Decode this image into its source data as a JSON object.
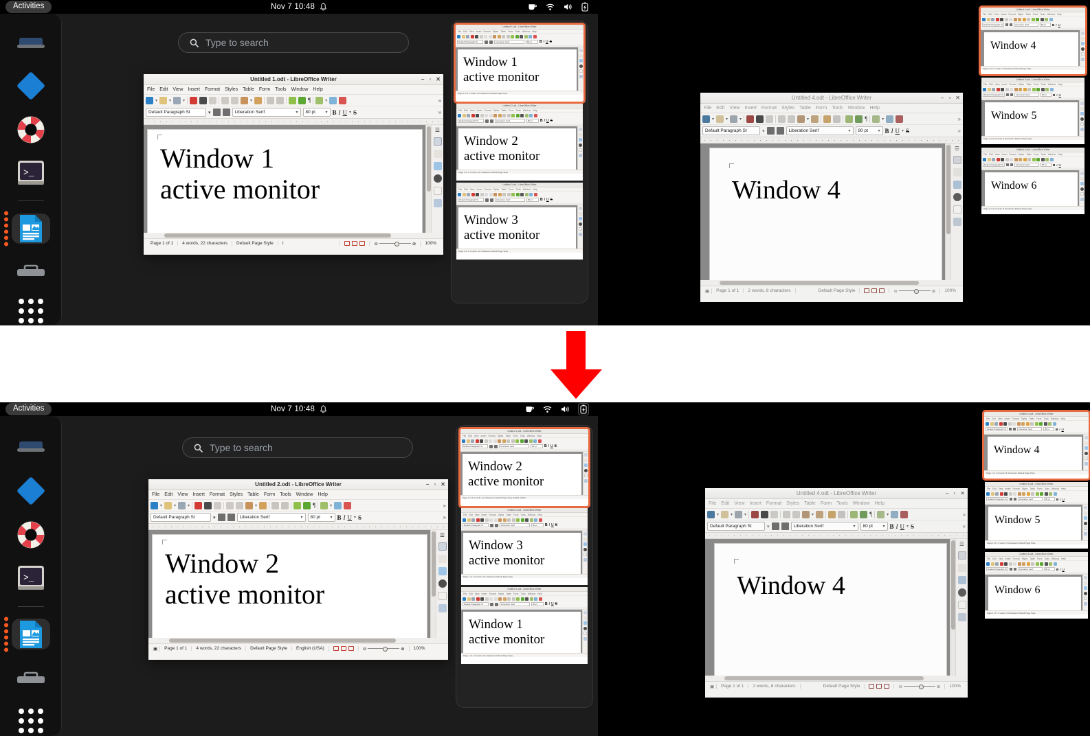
{
  "meta": {
    "description": "GNOME Shell Activities overview, before-and-after comparison of window focus across monitors",
    "accent_selected": "#e86a41",
    "arrow_color": "#ff0000",
    "panel_bg": "#000000",
    "overview_bg": "#1c1c1c"
  },
  "topbar": {
    "activities_label": "Activities",
    "clock": "Nov 7 10:48",
    "icons": [
      "bell-icon",
      "coffee-icon",
      "wifi-icon",
      "volume-icon",
      "battery-charging-icon"
    ]
  },
  "dock": {
    "items": [
      {
        "name": "system-settings",
        "icon": "blue-diamond-gear-icon"
      },
      {
        "name": "help",
        "icon": "lifebuoy-icon"
      },
      {
        "name": "terminal",
        "icon": "terminal-icon"
      },
      {
        "name": "libreoffice-writer",
        "icon": "writer-document-icon",
        "running_count": 6,
        "active": true
      },
      {
        "name": "files",
        "icon": "file-cabinet-icon"
      },
      {
        "name": "show-applications",
        "icon": "app-grid-icon"
      }
    ]
  },
  "search": {
    "placeholder": "Type to search",
    "icon": "search-icon"
  },
  "writer_ui": {
    "menu": [
      "File",
      "Edit",
      "View",
      "Insert",
      "Format",
      "Styles",
      "Table",
      "Form",
      "Tools",
      "Window",
      "Help"
    ],
    "paragraph_style": "Default Paragraph St",
    "font_name": "Liberation Serif",
    "font_size": "80 pt",
    "bold": "B",
    "italic": "I",
    "underline": "U",
    "strike": "S",
    "window_buttons": [
      "minimize",
      "maximize",
      "close"
    ],
    "overflow": "»"
  },
  "top_section": {
    "left_window": {
      "title": "Untitled 1.odt - LibreOffice Writer",
      "doc_lines": [
        "Window 1",
        "active monitor"
      ],
      "status": {
        "page": "Page 1 of 1",
        "words": "4 words, 22 characters",
        "page_style": "Default Page Style",
        "language": "",
        "zoom": "100%"
      },
      "focused": true
    },
    "right_window": {
      "title": "Untitled 4.odt - LibreOffice Writer",
      "doc_lines": [
        "Window 4"
      ],
      "status": {
        "page": "Page 1 of 1",
        "words": "2 words, 8 characters",
        "page_style": "Default Page Style",
        "language": "",
        "zoom": "100%"
      },
      "focused": false
    },
    "center_thumbnails": [
      {
        "title": "Untitled 1.odt - LibreOffice Writer",
        "lines": [
          "Window 1",
          "active monitor"
        ],
        "selected": true,
        "status": "Page 1 of 1   4 words, 22 characters   Default Page Style"
      },
      {
        "title": "Untitled 2.odt - LibreOffice Writer",
        "lines": [
          "Window 2",
          "active monitor"
        ],
        "selected": false,
        "status": "Page 1 of 1   4 words, 22 characters   Default Page Style"
      },
      {
        "title": "Untitled 3.odt - LibreOffice Writer",
        "lines": [
          "Window 3",
          "active monitor"
        ],
        "selected": false,
        "status": "Page 1 of 1   4 words, 22 characters   Default Page Style"
      }
    ],
    "right_thumbnails": [
      {
        "title": "Untitled 4.odt - LibreOffice Writer",
        "lines": [
          "Window 4"
        ],
        "selected": true,
        "status": "Page 1 of 1   2 words, 8 characters   Default Page Style"
      },
      {
        "title": "Untitled 5.odt - LibreOffice Writer",
        "lines": [
          "Window 5"
        ],
        "selected": false,
        "status": "Page 1 of 1   2 words, 8 characters   Default Page Style"
      },
      {
        "title": "Untitled 6.odt - LibreOffice Writer",
        "lines": [
          "Window 6"
        ],
        "selected": false,
        "status": "Page 1 of 1   2 words, 8 characters   Default Page Style"
      }
    ]
  },
  "bottom_section": {
    "left_window": {
      "title": "Untitled 2.odt - LibreOffice Writer",
      "doc_lines": [
        "Window 2",
        "active monitor"
      ],
      "status": {
        "page": "Page 1 of 1",
        "words": "4 words, 22 characters",
        "page_style": "Default Page Style",
        "language": "English (USA)",
        "zoom": "100%"
      },
      "focused": true
    },
    "right_window": {
      "title": "Untitled 4.odt - LibreOffice Writer",
      "doc_lines": [
        "Window 4"
      ],
      "status": {
        "page": "Page 1 of 1",
        "words": "2 words, 8 characters",
        "page_style": "Default Page Style",
        "language": "",
        "zoom": "100%"
      },
      "focused": false
    },
    "center_thumbnails": [
      {
        "title": "Untitled 2.odt - LibreOffice Writer",
        "lines": [
          "Window 2",
          "active monitor"
        ],
        "selected": true,
        "status": "Page 1 of 1   4 words, 22 characters   Default Page Style   English (USA)"
      },
      {
        "title": "Untitled 3.odt - LibreOffice Writer",
        "lines": [
          "Window 3",
          "active monitor"
        ],
        "selected": false,
        "status": "Page 1 of 1   4 words, 22 characters   Default Page Style"
      },
      {
        "title": "Untitled 1.odt - LibreOffice Writer",
        "lines": [
          "Window 1",
          "active monitor"
        ],
        "selected": false,
        "status": "Page 1 of 1   4 words, 22 characters   Default Page Style"
      }
    ],
    "right_thumbnails": [
      {
        "title": "Untitled 4.odt - LibreOffice Writer",
        "lines": [
          "Window 4"
        ],
        "selected": true,
        "status": "Page 1 of 1   2 words, 8 characters   Default Page Style"
      },
      {
        "title": "Untitled 5.odt - LibreOffice Writer",
        "lines": [
          "Window 5"
        ],
        "selected": false,
        "status": "Page 1 of 1   2 words, 8 characters   Default Page Style"
      },
      {
        "title": "Untitled 6.odt - LibreOffice Writer",
        "lines": [
          "Window 6"
        ],
        "selected": false,
        "status": "Page 1 of 1   2 words, 8 characters   Default Page Style"
      }
    ]
  },
  "arrow": {
    "direction": "down",
    "color": "#ff0000",
    "name": "down-arrow-annotation"
  }
}
